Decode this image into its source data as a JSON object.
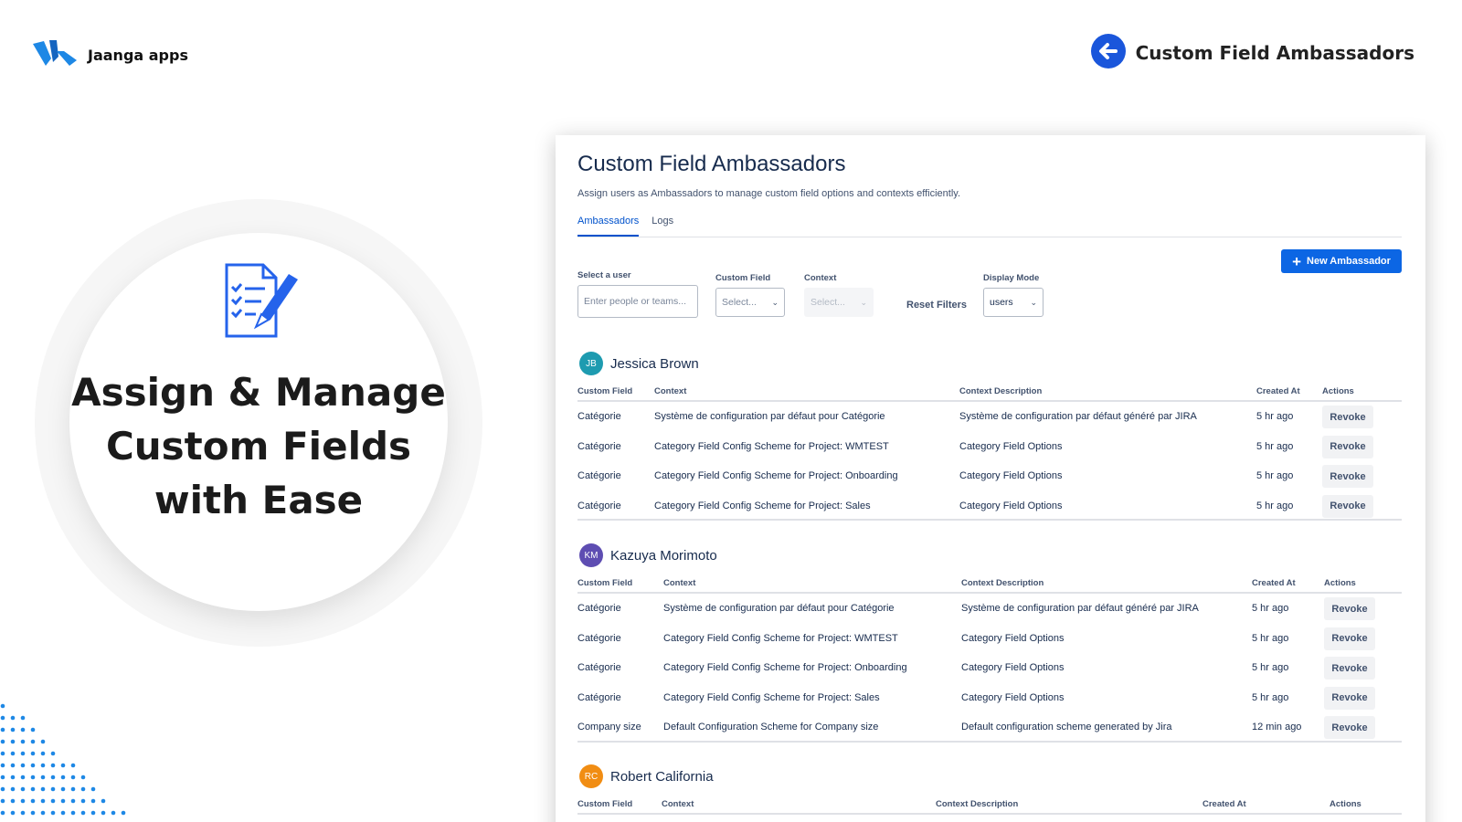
{
  "brand": {
    "name": "Jaanga apps",
    "logo_icon": "jaanga-logo-icon"
  },
  "product": {
    "name": "Custom Field Ambassadors",
    "icon": "arrow-left-circle-icon",
    "accent": "#1a56db"
  },
  "hero": {
    "title": "Assign & Manage\nCustom Fields\nwith Ease",
    "icon": "checklist-pencil-icon",
    "icon_color": "#2563eb"
  },
  "app": {
    "title": "Custom Field Ambassadors",
    "subtitle": "Assign users as Ambassadors to manage custom field options and contexts efficiently.",
    "tabs": [
      {
        "label": "Ambassadors",
        "active": true
      },
      {
        "label": "Logs",
        "active": false
      }
    ],
    "new_button": "New Ambassador",
    "filters": {
      "user_label": "Select a user",
      "user_placeholder": "Enter people or teams...",
      "field_label": "Custom Field",
      "field_value": "Select...",
      "context_label": "Context",
      "context_value": "Select...",
      "reset": "Reset Filters",
      "display_label": "Display Mode",
      "display_value": "users"
    },
    "columns": [
      "Custom Field",
      "Context",
      "Context Description",
      "Created At",
      "Actions"
    ],
    "revoke_label": "Revoke",
    "users": [
      {
        "initials": "JB",
        "name": "Jessica Brown",
        "color": "#1e9bb0",
        "rows": [
          [
            "Catégorie",
            "Système de configuration par défaut pour Catégorie",
            "Système de configuration par défaut généré par JIRA",
            "5 hr ago"
          ],
          [
            "Catégorie",
            "Category Field Config Scheme for Project: WMTEST",
            "Category Field Options",
            "5 hr ago"
          ],
          [
            "Catégorie",
            "Category Field Config Scheme for Project: Onboarding",
            "Category Field Options",
            "5 hr ago"
          ],
          [
            "Catégorie",
            "Category Field Config Scheme for Project: Sales",
            "Category Field Options",
            "5 hr ago"
          ]
        ]
      },
      {
        "initials": "KM",
        "name": "Kazuya Morimoto",
        "color": "#5e4db2",
        "rows": [
          [
            "Catégorie",
            "Système de configuration par défaut pour Catégorie",
            "Système de configuration par défaut généré par JIRA",
            "5 hr ago"
          ],
          [
            "Catégorie",
            "Category Field Config Scheme for Project: WMTEST",
            "Category Field Options",
            "5 hr ago"
          ],
          [
            "Catégorie",
            "Category Field Config Scheme for Project: Onboarding",
            "Category Field Options",
            "5 hr ago"
          ],
          [
            "Catégorie",
            "Category Field Config Scheme for Project: Sales",
            "Category Field Options",
            "5 hr ago"
          ],
          [
            "Company size",
            "Default Configuration Scheme for Company size",
            "Default configuration scheme generated by Jira",
            "12 min ago"
          ]
        ]
      },
      {
        "initials": "RC",
        "name": "Robert California",
        "color": "#f18d13",
        "rows": []
      }
    ]
  }
}
